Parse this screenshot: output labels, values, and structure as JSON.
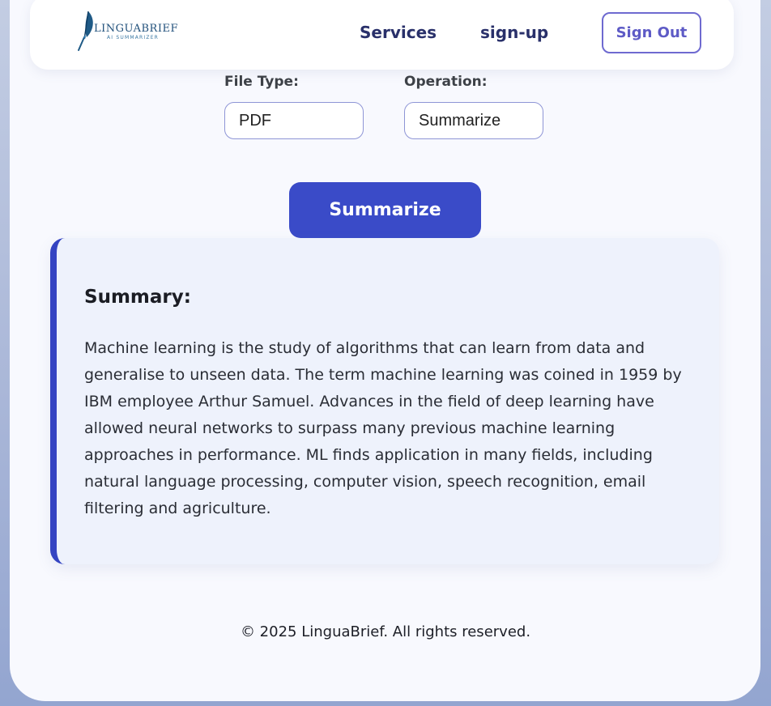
{
  "brand": {
    "name": "LINGUABRIEF",
    "tagline": "AI SUMMARIZER"
  },
  "nav": {
    "services_label": "Services",
    "signup_label": "sign-up",
    "signout_label": "Sign Out"
  },
  "form": {
    "file_type_label": "File Type:",
    "file_type_value": "PDF",
    "operation_label": "Operation:",
    "operation_value": "Summarize",
    "submit_label": "Summarize"
  },
  "summary": {
    "title": "Summary:",
    "text": "Machine learning is the study of algorithms that can learn from data and generalise to unseen data. The term machine learning was coined in 1959 by IBM employee Arthur Samuel. Advances in the field of deep learning have allowed neural networks to surpass many previous machine learning approaches in performance. ML finds application in many fields, including natural language processing, computer vision, speech recognition, email filtering and agriculture."
  },
  "footer": {
    "copyright": "© 2025 LinguaBrief. All rights reserved."
  },
  "colors": {
    "accent": "#3a4bc8",
    "nav_text": "#29306a",
    "signout_border": "#6e6ad0"
  },
  "icons": {
    "logo": "quill-pen-icon"
  }
}
